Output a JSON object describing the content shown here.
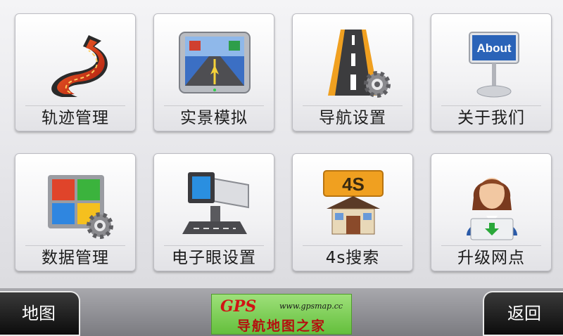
{
  "menu": {
    "items": [
      {
        "label": "轨迹管理",
        "icon": "track-road-icon"
      },
      {
        "label": "实景模拟",
        "icon": "navigation-screen-icon"
      },
      {
        "label": "导航设置",
        "icon": "road-gear-icon"
      },
      {
        "label": "关于我们",
        "icon": "about-sign-icon",
        "sign_text": "About"
      },
      {
        "label": "数据管理",
        "icon": "windows-gear-icon"
      },
      {
        "label": "电子眼设置",
        "icon": "camera-icon"
      },
      {
        "label": "4s搜索",
        "icon": "4s-shop-icon",
        "badge_text": "4S"
      },
      {
        "label": "升级网点",
        "icon": "service-agent-icon"
      }
    ]
  },
  "bottom_bar": {
    "left_button": "地图",
    "right_button": "返回",
    "logo": {
      "brand": "GPS",
      "url": "www.gpsmap.cc",
      "name": "导航地图之家"
    }
  },
  "colors": {
    "road_orange": "#f0a020",
    "accent_red": "#c8221c",
    "logo_green": "#6cc343",
    "bar_gray": "#8d8d92"
  }
}
